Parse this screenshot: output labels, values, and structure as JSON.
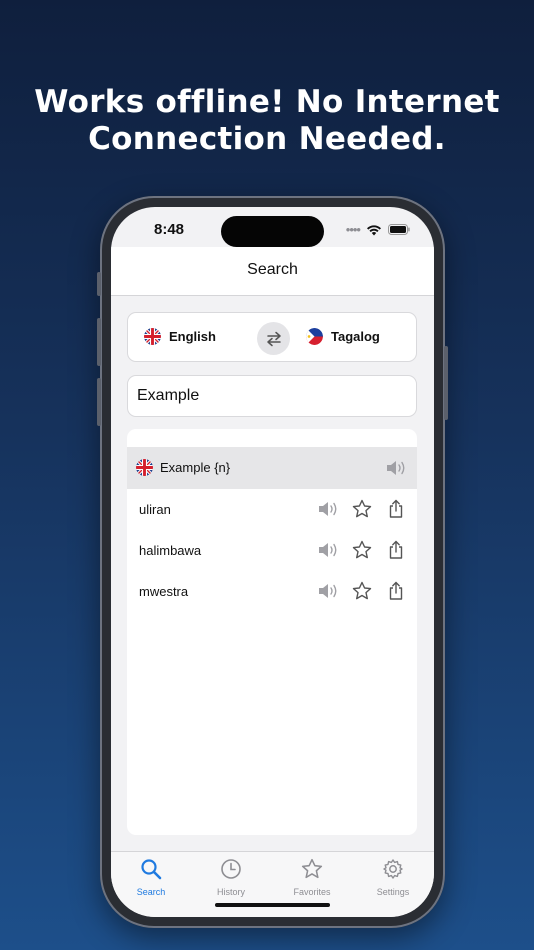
{
  "headline": {
    "line1": "Works offline! No Internet",
    "line2": "Connection Needed."
  },
  "status_bar": {
    "time": "8:48"
  },
  "nav": {
    "title": "Search"
  },
  "languages": {
    "source": "English",
    "target": "Tagalog",
    "source_flag": "uk-flag-icon",
    "target_flag": "philippines-flag-icon",
    "swap_icon": "swap-arrows-icon"
  },
  "search": {
    "value": "Example"
  },
  "result": {
    "term": "Example {n}",
    "translations": [
      {
        "word": "uliran"
      },
      {
        "word": "halimbawa"
      },
      {
        "word": "mwestra"
      }
    ]
  },
  "tabs": [
    {
      "label": "Search",
      "icon": "search-icon",
      "active": true
    },
    {
      "label": "History",
      "icon": "clock-icon",
      "active": false
    },
    {
      "label": "Favorites",
      "icon": "star-icon",
      "active": false
    },
    {
      "label": "Settings",
      "icon": "gear-icon",
      "active": false
    }
  ],
  "colors": {
    "accent": "#1f7ae0",
    "background_top": "#0f1f3d",
    "background_bottom": "#1d4f8a",
    "icon_gray": "#8e8e93"
  }
}
